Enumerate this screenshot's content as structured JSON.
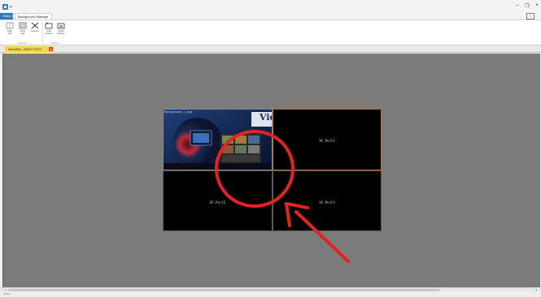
{
  "window": {
    "minimize": "–",
    "restore": "❐",
    "close": "×",
    "help": "?"
  },
  "ribbon": {
    "tabs": {
      "home": "Video Wall",
      "active": "Background Manage"
    },
    "buttons": [
      {
        "icon": "start-edit-icon",
        "label": "Start\nedit"
      },
      {
        "icon": "end-edit-icon",
        "label": "End\nedit"
      },
      {
        "icon": "cancel-icon",
        "label": "Cancel"
      },
      {
        "icon": "add-picture-icon",
        "label": "Add\npicture"
      },
      {
        "icon": "clear-picture-icon",
        "label": "Clear\npicture"
      }
    ],
    "groups": {
      "operate": "Operate",
      "picture": "Picture"
    }
  },
  "document_tab": {
    "label": "VideoWall - VIDEO TEXT2",
    "close": "x"
  },
  "videowall": {
    "background_name": "Background_1.jpg",
    "cells": [
      {
        "label": ""
      },
      {
        "label": "VC-Port1"
      },
      {
        "label": "VC-Port2"
      },
      {
        "label": "VC-Port3"
      }
    ],
    "logo_text": "Vie"
  },
  "annotation": {
    "circle_color": "#e52222",
    "arrow_color": "#e52222"
  },
  "status": {
    "text": "Status ..."
  }
}
